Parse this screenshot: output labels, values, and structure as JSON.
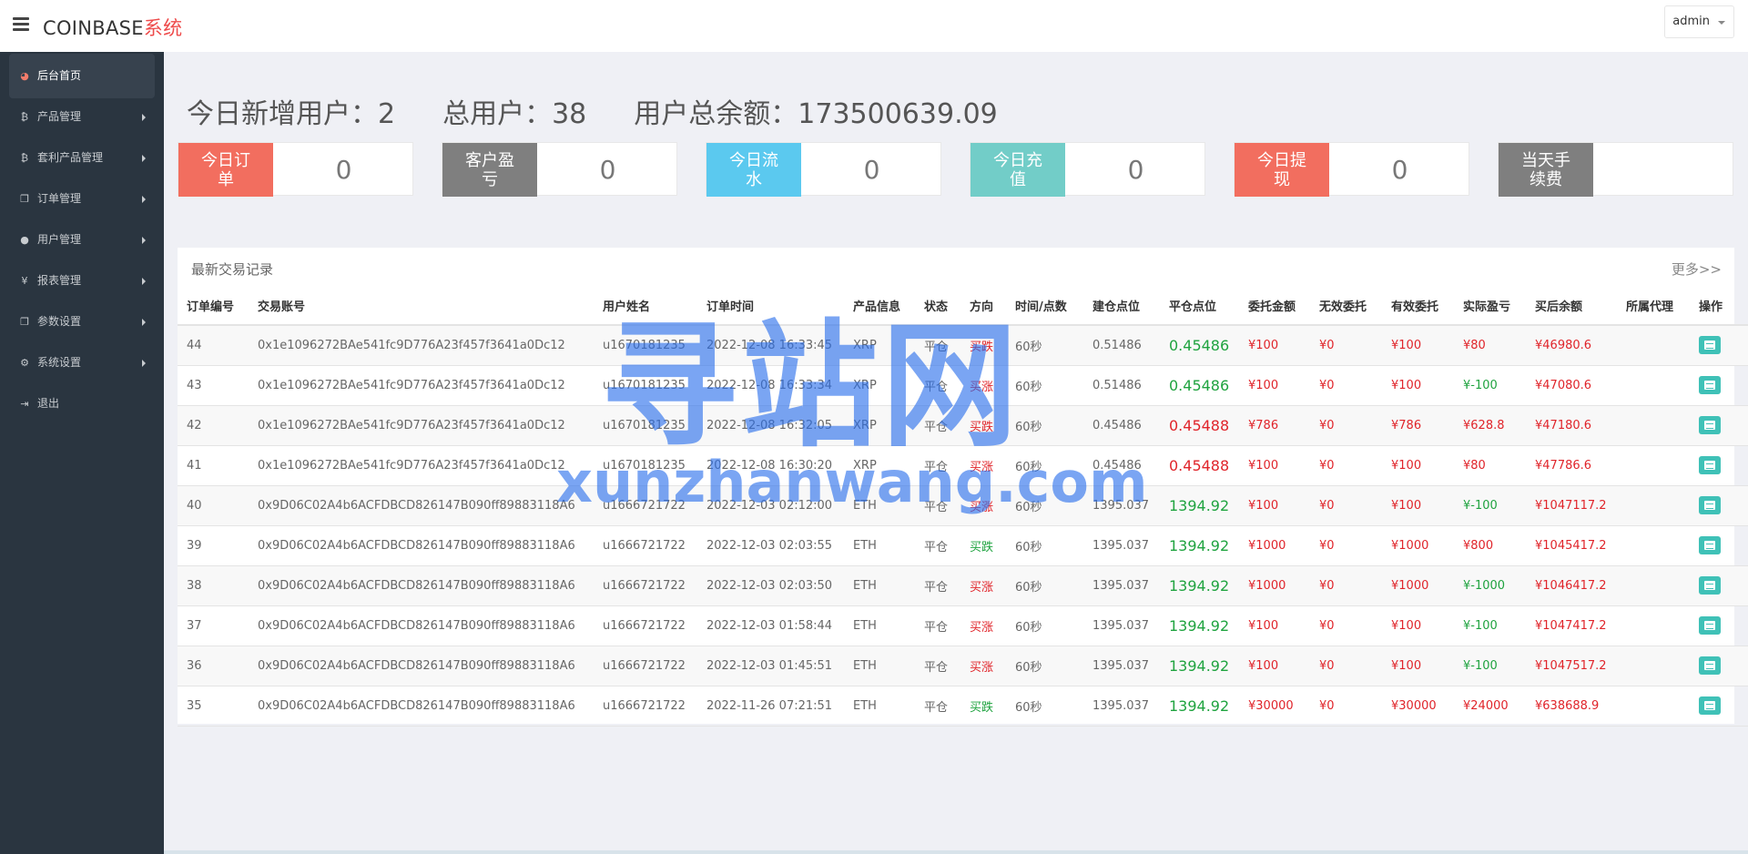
{
  "header": {
    "brand_main": "COINBASE",
    "brand_accent": "系统",
    "user": "admin"
  },
  "sidebar": {
    "items": [
      {
        "label": "后台首页",
        "icon": "dashboard-icon",
        "glyph": "◕"
      },
      {
        "label": "产品管理",
        "icon": "bitcoin-icon",
        "glyph": "₿"
      },
      {
        "label": "套利产品管理",
        "icon": "bitcoin-icon",
        "glyph": "₿"
      },
      {
        "label": "订单管理",
        "icon": "copy-icon",
        "glyph": "❐"
      },
      {
        "label": "用户管理",
        "icon": "user-icon",
        "glyph": "●"
      },
      {
        "label": "报表管理",
        "icon": "yen-icon",
        "glyph": "¥"
      },
      {
        "label": "参数设置",
        "icon": "copy-icon",
        "glyph": "❐"
      },
      {
        "label": "系统设置",
        "icon": "cogs-icon",
        "glyph": "⚙"
      },
      {
        "label": "退出",
        "icon": "sign-out-icon",
        "glyph": "⇥"
      }
    ]
  },
  "summary": {
    "new_users": "今日新增用户：2",
    "total_users": "总用户：38",
    "total_balance": "用户总余额：173500639.09"
  },
  "stats": [
    {
      "label": "今日订单",
      "value": "0",
      "color": "#f26e5f"
    },
    {
      "label": "客户盈亏",
      "value": "0",
      "color": "#7f7f7f"
    },
    {
      "label": "今日流水",
      "value": "0",
      "color": "#5bc9ef"
    },
    {
      "label": "今日充值",
      "value": "0",
      "color": "#72cdc8"
    },
    {
      "label": "今日提现",
      "value": "0",
      "color": "#f26e5f"
    },
    {
      "label": "当天手续费",
      "value": "",
      "color": "#7f7f7f"
    }
  ],
  "panel": {
    "title": "最新交易记录",
    "more": "更多>>"
  },
  "table": {
    "headers": [
      "订单编号",
      "交易账号",
      "用户姓名",
      "订单时间",
      "产品信息",
      "状态",
      "方向",
      "时间/点数",
      "建仓点位",
      "平仓点位",
      "委托金额",
      "无效委托",
      "有效委托",
      "实际盈亏",
      "买后余额",
      "所属代理",
      "操作"
    ],
    "rows": [
      {
        "id": "44",
        "account": "0x1e1096272BAe541fc9D776A23f457f3641a0Dc12",
        "user": "u1670181235",
        "time": "2022-12-08 16:33:45",
        "product": "XRP",
        "status": "平仓",
        "direction": "买跌",
        "dir_color": "red",
        "period": "60秒",
        "open": "0.51486",
        "close": "0.45486",
        "close_color": "green",
        "amount": "¥100",
        "invalid": "¥0",
        "valid": "¥100",
        "pnl": "¥80",
        "pnl_color": "red",
        "balance": "¥46980.6",
        "agent": ""
      },
      {
        "id": "43",
        "account": "0x1e1096272BAe541fc9D776A23f457f3641a0Dc12",
        "user": "u1670181235",
        "time": "2022-12-08 16:33:34",
        "product": "XRP",
        "status": "平仓",
        "direction": "买涨",
        "dir_color": "red",
        "period": "60秒",
        "open": "0.51486",
        "close": "0.45486",
        "close_color": "green",
        "amount": "¥100",
        "invalid": "¥0",
        "valid": "¥100",
        "pnl": "¥-100",
        "pnl_color": "green",
        "balance": "¥47080.6",
        "agent": ""
      },
      {
        "id": "42",
        "account": "0x1e1096272BAe541fc9D776A23f457f3641a0Dc12",
        "user": "u1670181235",
        "time": "2022-12-08 16:32:05",
        "product": "XRP",
        "status": "平仓",
        "direction": "买跌",
        "dir_color": "red",
        "period": "60秒",
        "open": "0.45486",
        "close": "0.45488",
        "close_color": "red",
        "amount": "¥786",
        "invalid": "¥0",
        "valid": "¥786",
        "pnl": "¥628.8",
        "pnl_color": "red",
        "balance": "¥47180.6",
        "agent": ""
      },
      {
        "id": "41",
        "account": "0x1e1096272BAe541fc9D776A23f457f3641a0Dc12",
        "user": "u1670181235",
        "time": "2022-12-08 16:30:20",
        "product": "XRP",
        "status": "平仓",
        "direction": "买涨",
        "dir_color": "red",
        "period": "60秒",
        "open": "0.45486",
        "close": "0.45488",
        "close_color": "red",
        "amount": "¥100",
        "invalid": "¥0",
        "valid": "¥100",
        "pnl": "¥80",
        "pnl_color": "red",
        "balance": "¥47786.6",
        "agent": ""
      },
      {
        "id": "40",
        "account": "0x9D06C02A4b6ACFDBCD826147B090ff89883118A6",
        "user": "u1666721722",
        "time": "2022-12-03 02:12:00",
        "product": "ETH",
        "status": "平仓",
        "direction": "买涨",
        "dir_color": "red",
        "period": "60秒",
        "open": "1395.037",
        "close": "1394.92",
        "close_color": "green",
        "amount": "¥100",
        "invalid": "¥0",
        "valid": "¥100",
        "pnl": "¥-100",
        "pnl_color": "green",
        "balance": "¥1047117.2",
        "agent": ""
      },
      {
        "id": "39",
        "account": "0x9D06C02A4b6ACFDBCD826147B090ff89883118A6",
        "user": "u1666721722",
        "time": "2022-12-03 02:03:55",
        "product": "ETH",
        "status": "平仓",
        "direction": "买跌",
        "dir_color": "green",
        "period": "60秒",
        "open": "1395.037",
        "close": "1394.92",
        "close_color": "green",
        "amount": "¥1000",
        "invalid": "¥0",
        "valid": "¥1000",
        "pnl": "¥800",
        "pnl_color": "red",
        "balance": "¥1045417.2",
        "agent": ""
      },
      {
        "id": "38",
        "account": "0x9D06C02A4b6ACFDBCD826147B090ff89883118A6",
        "user": "u1666721722",
        "time": "2022-12-03 02:03:50",
        "product": "ETH",
        "status": "平仓",
        "direction": "买涨",
        "dir_color": "red",
        "period": "60秒",
        "open": "1395.037",
        "close": "1394.92",
        "close_color": "green",
        "amount": "¥1000",
        "invalid": "¥0",
        "valid": "¥1000",
        "pnl": "¥-1000",
        "pnl_color": "green",
        "balance": "¥1046417.2",
        "agent": ""
      },
      {
        "id": "37",
        "account": "0x9D06C02A4b6ACFDBCD826147B090ff89883118A6",
        "user": "u1666721722",
        "time": "2022-12-03 01:58:44",
        "product": "ETH",
        "status": "平仓",
        "direction": "买涨",
        "dir_color": "red",
        "period": "60秒",
        "open": "1395.037",
        "close": "1394.92",
        "close_color": "green",
        "amount": "¥100",
        "invalid": "¥0",
        "valid": "¥100",
        "pnl": "¥-100",
        "pnl_color": "green",
        "balance": "¥1047417.2",
        "agent": ""
      },
      {
        "id": "36",
        "account": "0x9D06C02A4b6ACFDBCD826147B090ff89883118A6",
        "user": "u1666721722",
        "time": "2022-12-03 01:45:51",
        "product": "ETH",
        "status": "平仓",
        "direction": "买涨",
        "dir_color": "red",
        "period": "60秒",
        "open": "1395.037",
        "close": "1394.92",
        "close_color": "green",
        "amount": "¥100",
        "invalid": "¥0",
        "valid": "¥100",
        "pnl": "¥-100",
        "pnl_color": "green",
        "balance": "¥1047517.2",
        "agent": ""
      },
      {
        "id": "35",
        "account": "0x9D06C02A4b6ACFDBCD826147B090ff89883118A6",
        "user": "u1666721722",
        "time": "2022-11-26 07:21:51",
        "product": "ETH",
        "status": "平仓",
        "direction": "买跌",
        "dir_color": "green",
        "period": "60秒",
        "open": "1395.037",
        "close": "1394.92",
        "close_color": "green",
        "amount": "¥30000",
        "invalid": "¥0",
        "valid": "¥30000",
        "pnl": "¥24000",
        "pnl_color": "red",
        "balance": "¥638688.9",
        "agent": ""
      }
    ]
  },
  "watermark": {
    "big": "寻站网",
    "small": "xunzhanwang.com"
  }
}
